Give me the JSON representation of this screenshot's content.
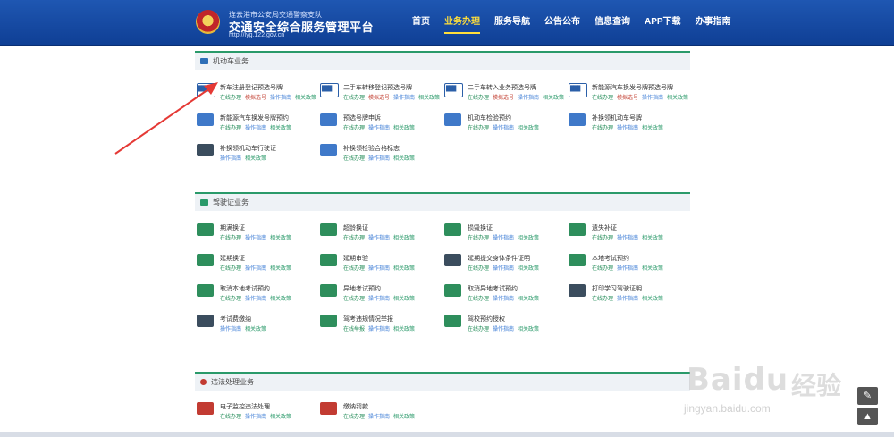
{
  "header": {
    "small": "连云港市公安局交通警察支队",
    "title": "交通安全综合服务管理平台",
    "url": "http://lyg.122.gov.cn"
  },
  "nav": [
    {
      "label": "首页",
      "active": false
    },
    {
      "label": "业务办理",
      "active": true
    },
    {
      "label": "服务导航",
      "active": false
    },
    {
      "label": "公告公布",
      "active": false
    },
    {
      "label": "信息查询",
      "active": false
    },
    {
      "label": "APP下载",
      "active": false
    },
    {
      "label": "办事指南",
      "active": false
    }
  ],
  "sections": {
    "vehicle": {
      "title": "机动车业务",
      "items": [
        {
          "name": "新车注册登记预选号牌",
          "links": [
            "在线办理",
            "模拟选号",
            "操作指南",
            "相关政策"
          ]
        },
        {
          "name": "二手车转移登记预选号牌",
          "links": [
            "在线办理",
            "模拟选号",
            "操作指南",
            "相关政策"
          ]
        },
        {
          "name": "二手车转入业务预选号牌",
          "links": [
            "在线办理",
            "模拟选号",
            "操作指南",
            "相关政策"
          ]
        },
        {
          "name": "新能源汽车换发号牌预选号牌",
          "links": [
            "在线办理",
            "模拟选号",
            "操作指南",
            "相关政策"
          ]
        },
        {
          "name": "新能源汽车换发号牌预约",
          "links": [
            "在线办理",
            "操作指南",
            "相关政策"
          ]
        },
        {
          "name": "预选号牌申诉",
          "links": [
            "在线办理",
            "操作指南",
            "相关政策"
          ]
        },
        {
          "name": "机动车检验预约",
          "links": [
            "在线办理",
            "操作指南",
            "相关政策"
          ]
        },
        {
          "name": "补换领机动车号牌",
          "links": [
            "在线办理",
            "操作指南",
            "相关政策"
          ]
        },
        {
          "name": "补换领机动车行驶证",
          "links": [
            "操作指南",
            "相关政策"
          ]
        },
        {
          "name": "补换领检验合格标志",
          "links": [
            "在线办理",
            "操作指南",
            "相关政策"
          ]
        }
      ]
    },
    "license": {
      "title": "驾驶证业务",
      "items": [
        {
          "name": "期满换证",
          "links": [
            "在线办理",
            "操作指南",
            "相关政策"
          ]
        },
        {
          "name": "超龄换证",
          "links": [
            "在线办理",
            "操作指南",
            "相关政策"
          ]
        },
        {
          "name": "损毁换证",
          "links": [
            "在线办理",
            "操作指南",
            "相关政策"
          ]
        },
        {
          "name": "遗失补证",
          "links": [
            "在线办理",
            "操作指南",
            "相关政策"
          ]
        },
        {
          "name": "延期换证",
          "links": [
            "在线办理",
            "操作指南",
            "相关政策"
          ]
        },
        {
          "name": "延期审验",
          "links": [
            "在线办理",
            "操作指南",
            "相关政策"
          ]
        },
        {
          "name": "延期提交身体条件证明",
          "links": [
            "在线办理",
            "操作指南",
            "相关政策"
          ]
        },
        {
          "name": "本地考试预约",
          "links": [
            "在线办理",
            "操作指南",
            "相关政策"
          ]
        },
        {
          "name": "取消本地考试预约",
          "links": [
            "在线办理",
            "操作指南",
            "相关政策"
          ]
        },
        {
          "name": "异地考试预约",
          "links": [
            "在线办理",
            "操作指南",
            "相关政策"
          ]
        },
        {
          "name": "取消异地考试预约",
          "links": [
            "在线办理",
            "操作指南",
            "相关政策"
          ]
        },
        {
          "name": "打印学习驾驶证明",
          "links": [
            "在线办理",
            "操作指南",
            "相关政策"
          ]
        },
        {
          "name": "考试费缴纳",
          "links": [
            "操作指南",
            "相关政策"
          ]
        },
        {
          "name": "驾考违规情况举报",
          "links": [
            "在线举报",
            "操作指南",
            "相关政策"
          ]
        },
        {
          "name": "驾校预约授权",
          "links": [
            "在线办理",
            "操作指南",
            "相关政策"
          ]
        }
      ]
    },
    "violation": {
      "title": "违法处理业务",
      "items": [
        {
          "name": "电子监控违法处理",
          "links": [
            "在线办理",
            "操作指南",
            "相关政策"
          ]
        },
        {
          "name": "缴纳罚款",
          "links": [
            "在线办理",
            "操作指南",
            "相关政策"
          ]
        }
      ]
    }
  },
  "watermark": {
    "main": "Bai",
    "paw": "du",
    "cn": "经验",
    "url": "jingyan.baidu.com"
  },
  "tools": [
    {
      "icon": "edit-icon",
      "glyph": "✎"
    },
    {
      "icon": "arrow-up-icon",
      "glyph": "▲"
    }
  ]
}
